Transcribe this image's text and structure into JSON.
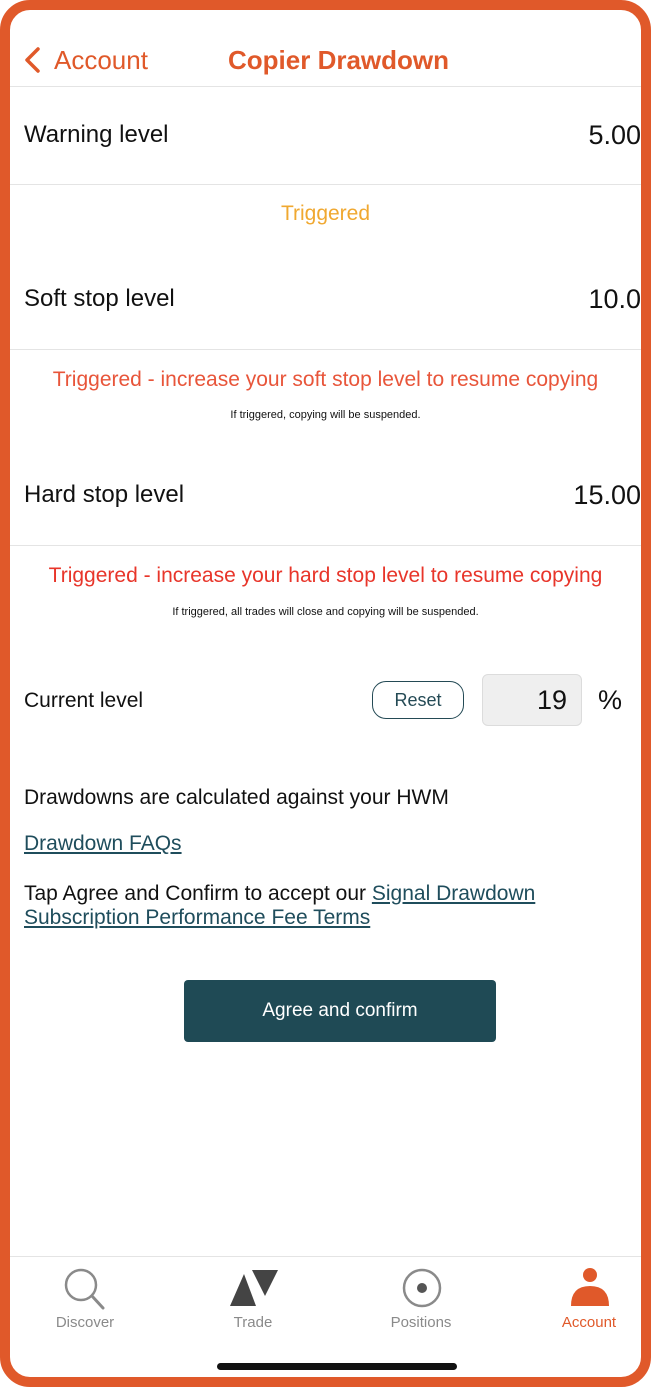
{
  "header": {
    "back_label": "Account",
    "title": "Copier Drawdown"
  },
  "levels": {
    "warning": {
      "label": "Warning level",
      "value": "5.00",
      "status": "Triggered"
    },
    "soft": {
      "label": "Soft stop level",
      "value": "10.0",
      "status": "Triggered - increase your soft stop level to resume copying",
      "note": "If triggered, copying will be suspended."
    },
    "hard": {
      "label": "Hard stop level",
      "value": "15.00",
      "status": "Triggered - increase your hard stop level to resume copying",
      "note": "If triggered, all trades will close and copying will be suspended."
    },
    "current": {
      "label": "Current level",
      "reset_label": "Reset",
      "value": "19",
      "unit": "%"
    }
  },
  "info": {
    "hwm_text": "Drawdowns are calculated against your HWM",
    "faq_link": "Drawdown FAQs",
    "terms_prefix": "Tap Agree and Confirm to accept our ",
    "terms_link": "Signal Drawdown Subscription Performance Fee Terms"
  },
  "confirm_button": "Agree and confirm",
  "tabbar": {
    "items": [
      {
        "label": "Discover",
        "icon": "search-icon",
        "active": false
      },
      {
        "label": "Trade",
        "icon": "trade-icon",
        "active": false
      },
      {
        "label": "Positions",
        "icon": "positions-icon",
        "active": false
      },
      {
        "label": "Account",
        "icon": "account-icon",
        "active": true
      }
    ]
  },
  "colors": {
    "accent": "#e0592a",
    "warning": "#f0a830",
    "soft_alert": "#e8553a",
    "hard_alert": "#e8352a",
    "primary_button": "#1f4a55"
  }
}
